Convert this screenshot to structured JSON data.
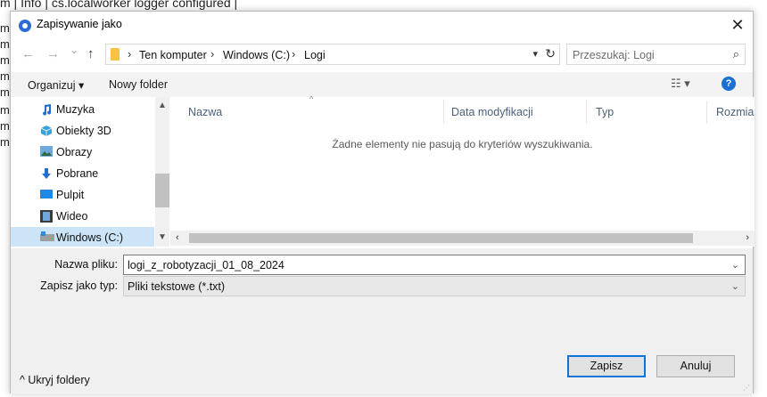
{
  "background": {
    "header_text": "m | Info | cs.localworker logger configured |",
    "margin_letter": "m"
  },
  "dialog": {
    "title": "Zapisywanie jako",
    "close_glyph": "✕"
  },
  "nav": {
    "back_glyph": "←",
    "forward_glyph": "→",
    "recent_glyph": "⌄",
    "up_glyph": "↑",
    "breadcrumb": [
      "Ten komputer",
      "Windows (C:)",
      "Logi"
    ],
    "separator_glyph": "›",
    "refresh_glyph": "↻",
    "search_placeholder": "Przeszukaj: Logi",
    "search_glyph": "⌕"
  },
  "toolbar": {
    "organize_label": "Organizuj ▾",
    "new_folder_label": "Nowy folder",
    "view_glyph": "☷ ▾",
    "help_glyph": "?"
  },
  "sidebar": {
    "items": [
      {
        "label": "Muzyka",
        "icon": "music-icon"
      },
      {
        "label": "Obiekty 3D",
        "icon": "cube-icon"
      },
      {
        "label": "Obrazy",
        "icon": "pictures-icon"
      },
      {
        "label": "Pobrane",
        "icon": "download-icon"
      },
      {
        "label": "Pulpit",
        "icon": "desktop-icon"
      },
      {
        "label": "Wideo",
        "icon": "video-icon"
      },
      {
        "label": "Windows (C:)",
        "icon": "drive-icon",
        "selected": true
      }
    ]
  },
  "filelist": {
    "columns": [
      "Nazwa",
      "Data modyfikacji",
      "Typ",
      "Rozmia"
    ],
    "empty_message": "Żadne elementy nie pasują do kryteriów wyszukiwania."
  },
  "form": {
    "filename_label": "Nazwa pliku:",
    "filename_value": "logi_z_robotyzacji_01_08_2024",
    "filetype_label": "Zapisz jako typ:",
    "filetype_value": "Pliki tekstowe (*.txt)",
    "hide_folders_label": "^ Ukryj foldery",
    "save_label": "Zapisz",
    "cancel_label": "Anuluj"
  },
  "colors": {
    "accent": "#0a74da",
    "selection": "#cce4f7",
    "help": "#1a6fd4"
  }
}
